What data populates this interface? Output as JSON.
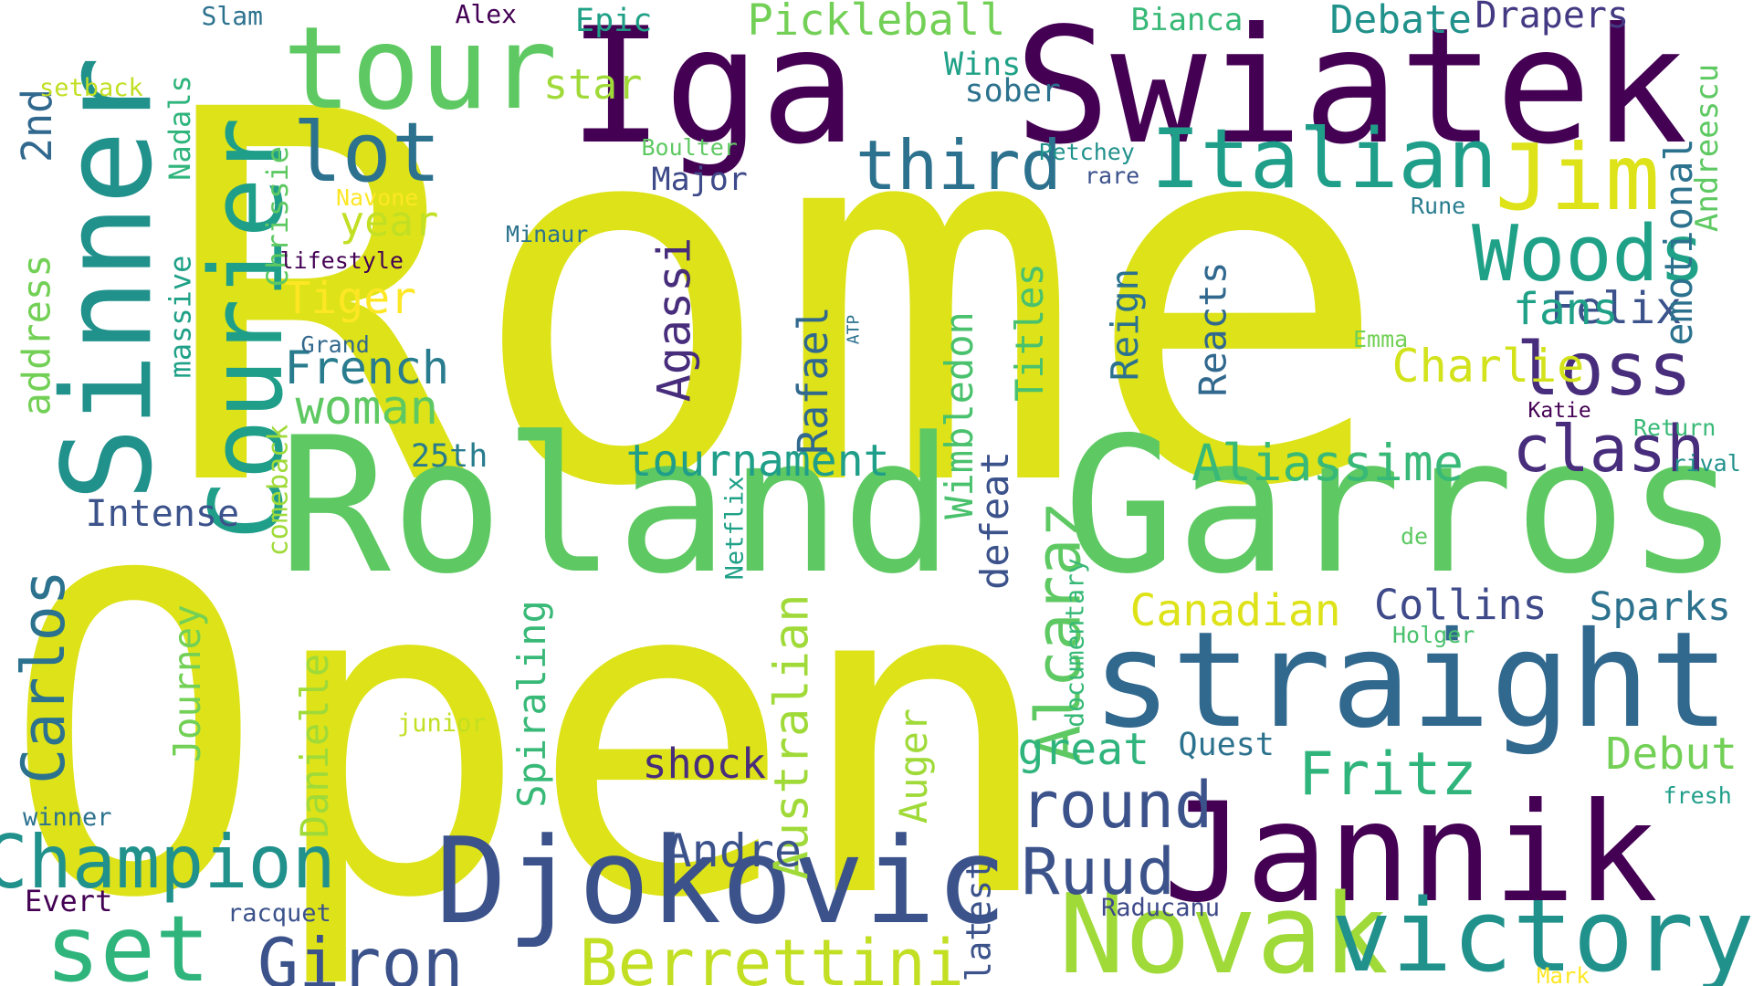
{
  "words": [
    {
      "text": "Rome",
      "color": "#dde318",
      "vertical": false
    },
    {
      "text": "Open",
      "color": "#dde318",
      "vertical": false
    },
    {
      "text": "Roland",
      "color": "#5ec962",
      "vertical": false
    },
    {
      "text": "Garros",
      "color": "#5ec962",
      "vertical": false
    },
    {
      "text": "Iga",
      "color": "#440154",
      "vertical": false
    },
    {
      "text": "Swiatek",
      "color": "#440154",
      "vertical": false
    },
    {
      "text": "straight",
      "color": "#31688e",
      "vertical": false
    },
    {
      "text": "Jannik",
      "color": "#440154",
      "vertical": false
    },
    {
      "text": "Djokovic",
      "color": "#3b528b",
      "vertical": false
    },
    {
      "text": "Novak",
      "color": "#a0da39",
      "vertical": false
    },
    {
      "text": "victory",
      "color": "#21918c",
      "vertical": false
    },
    {
      "text": "Sinner",
      "color": "#21918c",
      "vertical": true
    },
    {
      "text": "tour",
      "color": "#5ec962",
      "vertical": false
    },
    {
      "text": "Courier",
      "color": "#1f9e89",
      "vertical": true
    },
    {
      "text": "Italian",
      "color": "#1f9e89",
      "vertical": false
    },
    {
      "text": "Jim",
      "color": "#dde318",
      "vertical": false
    },
    {
      "text": "Woods",
      "color": "#1fa187",
      "vertical": false
    },
    {
      "text": "set",
      "color": "#2fb47c",
      "vertical": false
    },
    {
      "text": "Champion",
      "color": "#21918c",
      "vertical": false
    },
    {
      "text": "Berrettini",
      "color": "#c2df23",
      "vertical": false
    },
    {
      "text": "Giron",
      "color": "#3b528b",
      "vertical": false
    },
    {
      "text": "lot",
      "color": "#2c728e",
      "vertical": false
    },
    {
      "text": "third",
      "color": "#2c728e",
      "vertical": false
    },
    {
      "text": "loss",
      "color": "#472d7b",
      "vertical": false
    },
    {
      "text": "clash",
      "color": "#472d7b",
      "vertical": false
    },
    {
      "text": "Fritz",
      "color": "#2fb47c",
      "vertical": false
    },
    {
      "text": "round",
      "color": "#3b528b",
      "vertical": false
    },
    {
      "text": "Ruud",
      "color": "#3b528b",
      "vertical": false
    },
    {
      "text": "Alcaraz",
      "color": "#5ec962",
      "vertical": true
    },
    {
      "text": "Australian",
      "color": "#a0da39",
      "vertical": true
    },
    {
      "text": "Carlos",
      "color": "#2c728e",
      "vertical": true
    },
    {
      "text": "Aliassime",
      "color": "#38b977",
      "vertical": false
    },
    {
      "text": "Collins",
      "color": "#3e4a89",
      "vertical": false
    },
    {
      "text": "Canadian",
      "color": "#dde318",
      "vertical": false
    },
    {
      "text": "Sparks",
      "color": "#2c728e",
      "vertical": false
    },
    {
      "text": "Debut",
      "color": "#73d056",
      "vertical": false
    },
    {
      "text": "tournament",
      "color": "#1f9e89",
      "vertical": false
    },
    {
      "text": "French",
      "color": "#287c8e",
      "vertical": false
    },
    {
      "text": "woman",
      "color": "#5ec962",
      "vertical": false
    },
    {
      "text": "Charlie",
      "color": "#d2e21b",
      "vertical": false
    },
    {
      "text": "Felix",
      "color": "#3b528b",
      "vertical": false
    },
    {
      "text": "fans",
      "color": "#1fa187",
      "vertical": false
    },
    {
      "text": "emotional",
      "color": "#2c728e",
      "vertical": true
    },
    {
      "text": "Andreescu",
      "color": "#5ec962",
      "vertical": true
    },
    {
      "text": "Andre",
      "color": "#3b528b",
      "vertical": false
    },
    {
      "text": "shock",
      "color": "#472d7b",
      "vertical": false
    },
    {
      "text": "great",
      "color": "#2fb47c",
      "vertical": false
    },
    {
      "text": "Quest",
      "color": "#2c728e",
      "vertical": false
    },
    {
      "text": "Pickleball",
      "color": "#73d056",
      "vertical": false
    },
    {
      "text": "Debate",
      "color": "#21918c",
      "vertical": false
    },
    {
      "text": "Drapers",
      "color": "#443a83",
      "vertical": false
    },
    {
      "text": "Bianca",
      "color": "#38b977",
      "vertical": false
    },
    {
      "text": "Epic",
      "color": "#1fa187",
      "vertical": false
    },
    {
      "text": "star",
      "color": "#a0da39",
      "vertical": false
    },
    {
      "text": "Wins",
      "color": "#1fa187",
      "vertical": false
    },
    {
      "text": "sober",
      "color": "#2c728e",
      "vertical": false
    },
    {
      "text": "Major",
      "color": "#3e4a89",
      "vertical": false
    },
    {
      "text": "year",
      "color": "#c2df23",
      "vertical": false
    },
    {
      "text": "Tiger",
      "color": "#fde725",
      "vertical": false
    },
    {
      "text": "Agassi",
      "color": "#472d7b",
      "vertical": true
    },
    {
      "text": "Rafael",
      "color": "#31688e",
      "vertical": true
    },
    {
      "text": "Wimbledon",
      "color": "#4ac16d",
      "vertical": true
    },
    {
      "text": "Titles",
      "color": "#4ac16d",
      "vertical": true
    },
    {
      "text": "Reign",
      "color": "#2c728e",
      "vertical": true
    },
    {
      "text": "Reacts",
      "color": "#31688e",
      "vertical": true
    },
    {
      "text": "Nadals",
      "color": "#2fb47c",
      "vertical": true
    },
    {
      "text": "massive",
      "color": "#1fa187",
      "vertical": true
    },
    {
      "text": "Chrissie",
      "color": "#5ec962",
      "vertical": true
    },
    {
      "text": "2nd",
      "color": "#31688e",
      "vertical": true
    },
    {
      "text": "address",
      "color": "#73d056",
      "vertical": true
    },
    {
      "text": "Intense",
      "color": "#3b528b",
      "vertical": false
    },
    {
      "text": "25th",
      "color": "#287c8e",
      "vertical": false
    },
    {
      "text": "comeback",
      "color": "#a0da39",
      "vertical": true
    },
    {
      "text": "defeat",
      "color": "#3b528b",
      "vertical": true
    },
    {
      "text": "Spiraling",
      "color": "#38b977",
      "vertical": true
    },
    {
      "text": "Journey",
      "color": "#73d056",
      "vertical": true
    },
    {
      "text": "Danielle",
      "color": "#a0da39",
      "vertical": true
    },
    {
      "text": "Auger",
      "color": "#a0da39",
      "vertical": true
    },
    {
      "text": "latest",
      "color": "#3b528b",
      "vertical": true
    },
    {
      "text": "Netflix",
      "color": "#1fa187",
      "vertical": true
    },
    {
      "text": "documentary",
      "color": "#38b977",
      "vertical": true
    },
    {
      "text": "ATP",
      "color": "#2c728e",
      "vertical": true
    },
    {
      "text": "Slam",
      "color": "#2c728e",
      "vertical": false
    },
    {
      "text": "Alex",
      "color": "#440154",
      "vertical": false
    },
    {
      "text": "setback",
      "color": "#c2df23",
      "vertical": false
    },
    {
      "text": "Boulter",
      "color": "#5ec962",
      "vertical": false
    },
    {
      "text": "Petchey",
      "color": "#21918c",
      "vertical": false
    },
    {
      "text": "rare",
      "color": "#3b528b",
      "vertical": false
    },
    {
      "text": "Navone",
      "color": "#fde725",
      "vertical": false
    },
    {
      "text": "Minaur",
      "color": "#2c728e",
      "vertical": false
    },
    {
      "text": "lifestyle",
      "color": "#440154",
      "vertical": false
    },
    {
      "text": "Grand",
      "color": "#31688e",
      "vertical": false
    },
    {
      "text": "Rune",
      "color": "#287c8e",
      "vertical": false
    },
    {
      "text": "Emma",
      "color": "#73d056",
      "vertical": false
    },
    {
      "text": "Katie",
      "color": "#440154",
      "vertical": false
    },
    {
      "text": "Return",
      "color": "#38b977",
      "vertical": false
    },
    {
      "text": "rival",
      "color": "#21918c",
      "vertical": false
    },
    {
      "text": "de",
      "color": "#5ec962",
      "vertical": false
    },
    {
      "text": "Holger",
      "color": "#4ac16d",
      "vertical": false
    },
    {
      "text": "fresh",
      "color": "#1f9e89",
      "vertical": false
    },
    {
      "text": "junior",
      "color": "#c2df23",
      "vertical": false
    },
    {
      "text": "winner",
      "color": "#2c728e",
      "vertical": false
    },
    {
      "text": "Evert",
      "color": "#440154",
      "vertical": false
    },
    {
      "text": "racquet",
      "color": "#3b528b",
      "vertical": false
    },
    {
      "text": "Raducanu",
      "color": "#3e4a89",
      "vertical": false
    },
    {
      "text": "Mark",
      "color": "#fde725",
      "vertical": false
    }
  ]
}
